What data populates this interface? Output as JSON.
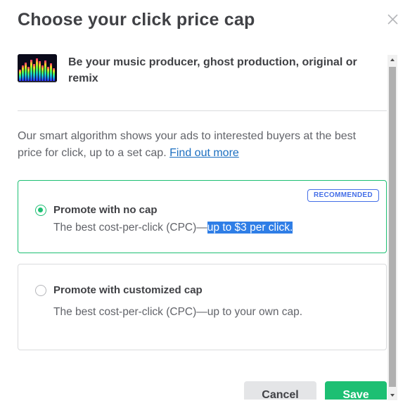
{
  "modal": {
    "title": "Choose your click price cap",
    "close_icon": "close-icon"
  },
  "gig": {
    "thumbnail_icon": "equalizer-thumbnail",
    "title": "Be your music producer, ghost production, original or remix"
  },
  "description": {
    "text": "Our smart algorithm shows your ads to interested buyers at the best price for click, up to a set cap. ",
    "link_text": "Find out more"
  },
  "options": [
    {
      "label": "Promote with no cap",
      "description_prefix": "The best cost-per-click (CPC)—",
      "description_highlight": "up to $3 per click.",
      "badge": "RECOMMENDED",
      "selected": true
    },
    {
      "label": "Promote with customized cap",
      "description": "The best cost-per-click (CPC)—up to your own cap.",
      "selected": false
    }
  ],
  "footer": {
    "cancel_label": "Cancel",
    "save_label": "Save"
  },
  "colors": {
    "accent_green": "#1dbf73",
    "link_blue": "#1c6fc0",
    "badge_blue": "#446ee7",
    "selection_blue": "#2f7ee6"
  }
}
